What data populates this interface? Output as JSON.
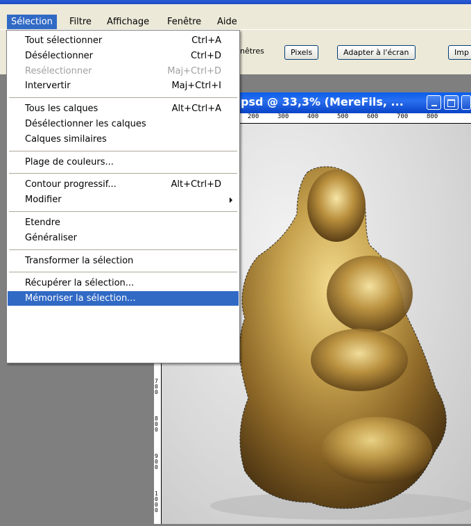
{
  "menubar": {
    "items": [
      "Sélection",
      "Filtre",
      "Affichage",
      "Fenêtre",
      "Aide"
    ],
    "active": "Sélection"
  },
  "options_bar": {
    "partial_label": "nêtres",
    "buttons": [
      "Pixels",
      "Adapter à l'écran",
      "Imp"
    ]
  },
  "document": {
    "title": "psd @ 33,3% (MereFils, ...",
    "h_ruler_ticks": [
      "200",
      "300",
      "400",
      "500",
      "600",
      "700",
      "800"
    ],
    "v_ruler_labels": [
      "7\n0\n0",
      "8\n0\n0",
      "9\n0\n0",
      "1\n0\n0\n0"
    ]
  },
  "menu": {
    "groups": [
      [
        {
          "label": "Tout sélectionner",
          "shortcut": "Ctrl+A",
          "disabled": false
        },
        {
          "label": "Désélectionner",
          "shortcut": "Ctrl+D",
          "disabled": false
        },
        {
          "label": "Resélectionner",
          "shortcut": "Maj+Ctrl+D",
          "disabled": true
        },
        {
          "label": "Intervertir",
          "shortcut": "Maj+Ctrl+I",
          "disabled": false
        }
      ],
      [
        {
          "label": "Tous les calques",
          "shortcut": "Alt+Ctrl+A",
          "disabled": false
        },
        {
          "label": "Désélectionner les calques",
          "shortcut": "",
          "disabled": false
        },
        {
          "label": "Calques similaires",
          "shortcut": "",
          "disabled": false
        }
      ],
      [
        {
          "label": "Plage de couleurs...",
          "shortcut": "",
          "disabled": false
        }
      ],
      [
        {
          "label": "Contour progressif...",
          "shortcut": "Alt+Ctrl+D",
          "disabled": false
        },
        {
          "label": "Modifier",
          "shortcut": "",
          "disabled": false,
          "submenu": true
        }
      ],
      [
        {
          "label": "Etendre",
          "shortcut": "",
          "disabled": false
        },
        {
          "label": "Généraliser",
          "shortcut": "",
          "disabled": false
        }
      ],
      [
        {
          "label": "Transformer la sélection",
          "shortcut": "",
          "disabled": false
        }
      ],
      [
        {
          "label": "Récupérer la sélection...",
          "shortcut": "",
          "disabled": false
        },
        {
          "label": "Mémoriser la sélection...",
          "shortcut": "",
          "disabled": false,
          "highlighted": true
        }
      ]
    ]
  },
  "colors": {
    "highlight": "#316ac5",
    "menubar_bg": "#ece9d8",
    "workspace": "#7f7f7f",
    "title_blue": "#0a5ee9"
  }
}
